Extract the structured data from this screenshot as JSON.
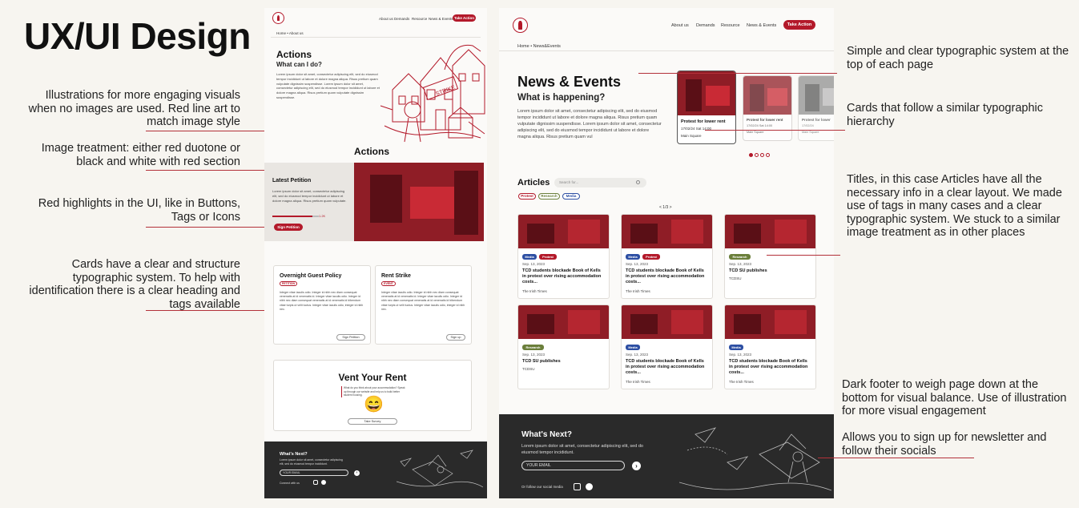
{
  "page_title": "UX/UI Design",
  "annotations": {
    "illustrations": "Illustrations for more engaging visuals when no images are used. Red line art to match image style",
    "image_treatment": "Image treatment: either red duotone or black and white with red section",
    "red_highlights": "Red highlights in the UI, like in Buttons, Tags or Icons",
    "cards": "Cards have a clear and structure typographic system. To help with identification there is a clear heading and tags available",
    "typography": "Simple and clear typographic system at the top of each page",
    "cards_hierarchy": "Cards that follow a similar typographic hierarchy",
    "titles": "Titles, in this case Articles have all the necessary info in a clear layout. We made use of tags in many cases and a clear typographic system. We stuck to a similar image treatment as in other places",
    "footer": "Dark footer to weigh page down at the bottom for visual balance. Use of illustration for more visual engagement",
    "footer2": "Allows you to sign up for newsletter and follow their socials"
  },
  "nav": {
    "links": [
      "About us",
      "Demands",
      "Resource",
      "News & Events"
    ],
    "cta": "Take Action"
  },
  "actions_page": {
    "breadcrumb": "Home  •  About us",
    "title": "Actions",
    "subtitle": "What can I do?",
    "lorem": "Lorem ipsum dolor sit amet, consectetur adipiscing elit, sed do eiusmod tempor incididunt ut labore et dolore magna aliqua. Risus pretium quam vulputate dignissim suspendisse. Lorem ipsum dolor sit amet, consectetur adipiscing elit, sed do eiusmod tempor incididunt ut labore et dolore magna aliqua. Risus pretium quam vulputate dignissim suspendisse.",
    "section_title": "Actions",
    "petition": {
      "heading": "Latest Petition",
      "text": "Lorem ipsum dolor sit amet, consectetur adipiscing elit, sed do eiusmod tempor incididunt ut labore et dolore magna aliqua. Risus pretium quam vulputate.",
      "count": "1.2K",
      "button": "Sign Petition"
    },
    "cards": [
      {
        "title": "Overnight Guest Policy",
        "tag": "PETITION",
        "text": "Integer vitae iaculis odio. Integer id nibh nec diam consequat venenatis at id venenatis id. Integer vitae iaculis odio. Integer id nibh nec diam consequat venenatis at id venenatis id bibendum vitae turpis ut velit luctus. Integer vitae iaculis odio, integer id nibh nec.",
        "button": "Sign Petition"
      },
      {
        "title": "Rent Strike",
        "tag": "EVENT",
        "text": "Integer vitae iaculis odio. Integer id nibh nec diam consequat venenatis at id venenatis id. Integer vitae iaculis odio. Integer id nibh nec diam consequat venenatis at id venenatis id bibendum vitae turpis ut velit luctus. Integer vitae iaculis odio, integer id nibh nec.",
        "button": "Sign up"
      }
    ],
    "vent": {
      "title": "Vent Your Rent",
      "text": "What do you think about your accommodation? Speak up through our website and help us to build better student housing.",
      "emoji": "😄",
      "button": "Take Survey"
    },
    "footer": {
      "title": "What's Next?",
      "text": "Lorem ipsum dolor sit amet, consectetur adipiscing elit, sed do eiusmod tempor incididunt.",
      "email_placeholder": "YOUR EMAIL",
      "social": "Connect with us"
    }
  },
  "news_page": {
    "breadcrumb": "Home  •  News&Events",
    "title": "News & Events",
    "subtitle": "What is happening?",
    "lorem": "Lorem ipsum dolor sit amet, consectetur adipiscing elit, sed do eiusmod tempor incididunt ut labore et dolore magna aliqua. Risus pretium quam vulputate dignissim suspendisse. Lorem ipsum dolor sit amet, consectetur adipiscing elit, sed do eiusmod tempor incididunt ut labore et dolore magna aliqua. Risus pretium quam vul",
    "event_cards": [
      {
        "title": "Protest for lower rent",
        "date": "17/02/24 Sat 14:00",
        "location": "Main Square"
      },
      {
        "title": "Protest for lower rent",
        "date": "17/02/24 Sat 14:00",
        "location": "Main Square"
      },
      {
        "title": "Protest for lower",
        "date": "17/02/24",
        "location": "Main Square"
      }
    ],
    "articles_title": "Articles",
    "search_placeholder": "Search for...",
    "filters": [
      "Protest",
      "Research",
      "Media"
    ],
    "pagination": "< 1/3 >",
    "articles": [
      {
        "tags": [
          "Media",
          "Protest"
        ],
        "date": "Sep. 13, 2023",
        "title": "TCD students blockade Book of Kells in protest over rising accommodation costs...",
        "source": "The Irish Times"
      },
      {
        "tags": [
          "Media",
          "Protest"
        ],
        "date": "Sep. 13, 2023",
        "title": "TCD students blockade Book of Kells in protest over rising accommodation costs...",
        "source": "The Irish Times"
      },
      {
        "tags": [
          "Research"
        ],
        "date": "Sep. 13, 2023",
        "title": "TCD SU publishes",
        "source": "TCDSU"
      },
      {
        "tags": [
          "Research"
        ],
        "date": "Sep. 13, 2023",
        "title": "TCD SU publishes",
        "source": "TCDSU"
      },
      {
        "tags": [
          "Media"
        ],
        "date": "Sep. 13, 2023",
        "title": "TCD students blockade Book of Kells in protest over rising accommodation costs...",
        "source": "The Irish Times"
      },
      {
        "tags": [
          "Media"
        ],
        "date": "Sep. 13, 2023",
        "title": "TCD students blockade Book of Kells in protest over rising accommodation costs...",
        "source": "The Irish Times"
      }
    ],
    "footer": {
      "title": "What's Next?",
      "text": "Lorem ipsum dolor sit amet, consectetur adipiscing elit, sed do eiusmod tempor incididunt.",
      "email_placeholder": "YOUR EMAIL",
      "social": "Or follow our social media"
    }
  }
}
